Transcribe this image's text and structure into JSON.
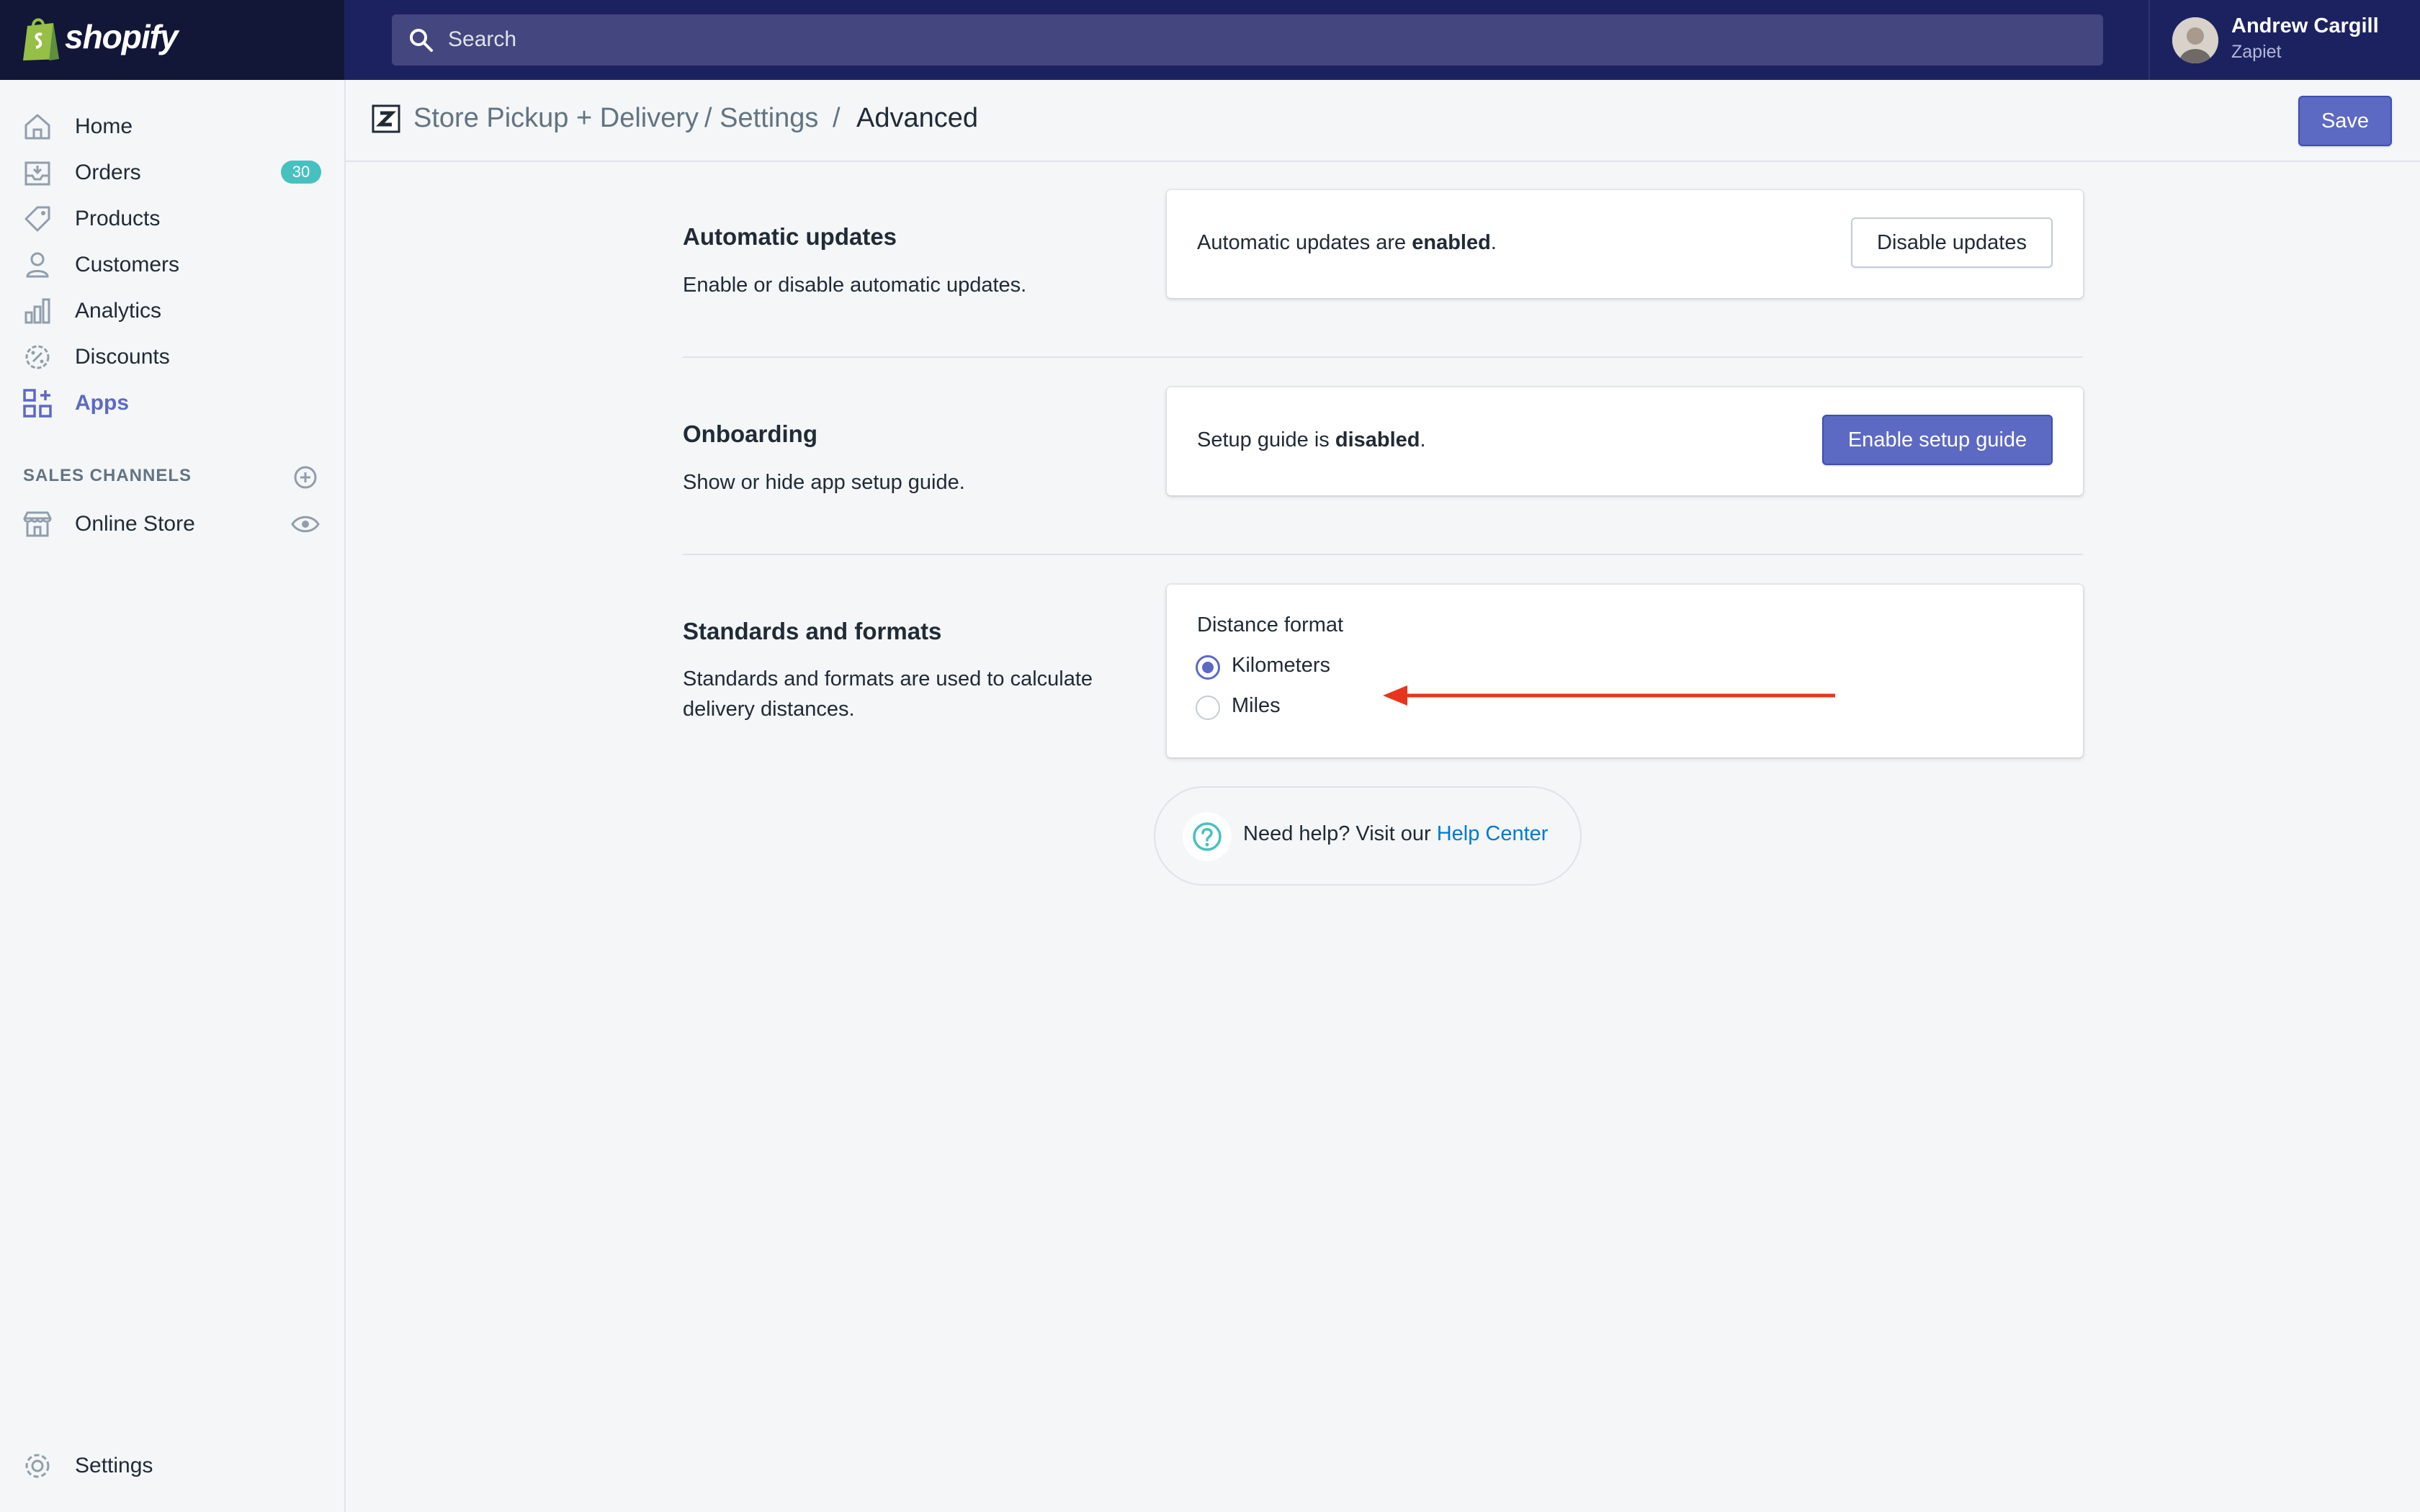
{
  "brand": {
    "name": "shopify"
  },
  "search": {
    "placeholder": "Search"
  },
  "user": {
    "name": "Andrew Cargill",
    "org": "Zapiet"
  },
  "sidebar": {
    "items": [
      {
        "label": "Home",
        "icon": "home-icon"
      },
      {
        "label": "Orders",
        "icon": "orders-icon",
        "badge": "30"
      },
      {
        "label": "Products",
        "icon": "tag-icon"
      },
      {
        "label": "Customers",
        "icon": "person-icon"
      },
      {
        "label": "Analytics",
        "icon": "bar-chart-icon"
      },
      {
        "label": "Discounts",
        "icon": "discount-icon"
      },
      {
        "label": "Apps",
        "icon": "apps-icon",
        "active": true
      }
    ],
    "sales_channels_heading": "SALES CHANNELS",
    "online_store": {
      "label": "Online Store"
    },
    "settings": {
      "label": "Settings"
    }
  },
  "header": {
    "breadcrumb": [
      "Store Pickup + Delivery",
      "/ Settings",
      "/",
      "Advanced"
    ],
    "save_label": "Save"
  },
  "sections": {
    "automatic_updates": {
      "title": "Automatic updates",
      "description": "Enable or disable automatic updates.",
      "status_prefix": "Automatic updates are ",
      "status_value": "enabled",
      "status_suffix": ".",
      "button_label": "Disable updates"
    },
    "onboarding": {
      "title": "Onboarding",
      "description": "Show or hide app setup guide.",
      "status_prefix": "Setup guide is ",
      "status_value": "disabled",
      "status_suffix": ".",
      "button_label": "Enable setup guide"
    },
    "standards": {
      "title": "Standards and formats",
      "description": "Standards and formats are used to calculate delivery distances.",
      "field_label": "Distance format",
      "options": [
        "Kilometers",
        "Miles"
      ],
      "selected": "Kilometers"
    }
  },
  "help": {
    "text": "Need help? Visit our ",
    "link_label": "Help Center"
  },
  "colors": {
    "topbar": "#1c2260",
    "brand_bg": "#121637",
    "primary": "#5c6ac4",
    "badge": "#47c1bf",
    "link": "#007ace",
    "annotation_arrow": "#e8341c"
  }
}
